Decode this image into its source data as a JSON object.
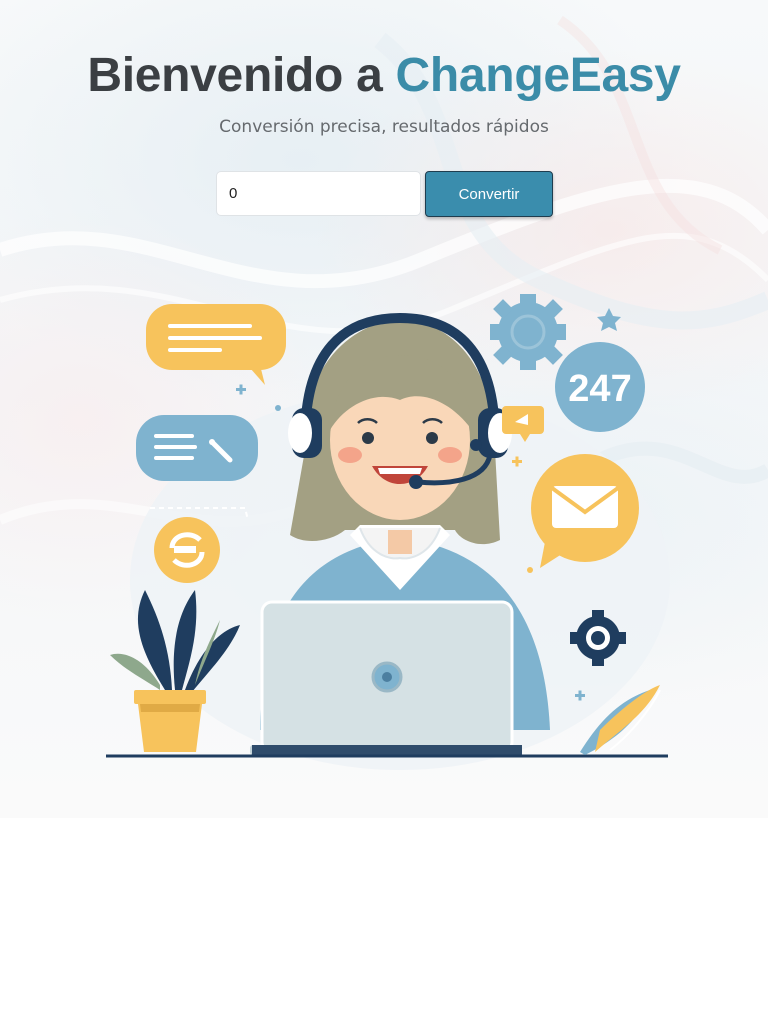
{
  "header": {
    "title_prefix": "Bienvenido a ",
    "title_brand": "ChangeEasy",
    "subtitle": "Conversión precisa, resultados rápidos"
  },
  "converter": {
    "amount_value": "0",
    "button_label": "Convertir"
  },
  "illustration": {
    "badge_text": "247"
  },
  "colors": {
    "brand": "#3b8ca8",
    "title": "#3b3f43",
    "button": "#3a8dad",
    "accent_yellow": "#f7c35c",
    "accent_blue": "#7fb3cf"
  }
}
